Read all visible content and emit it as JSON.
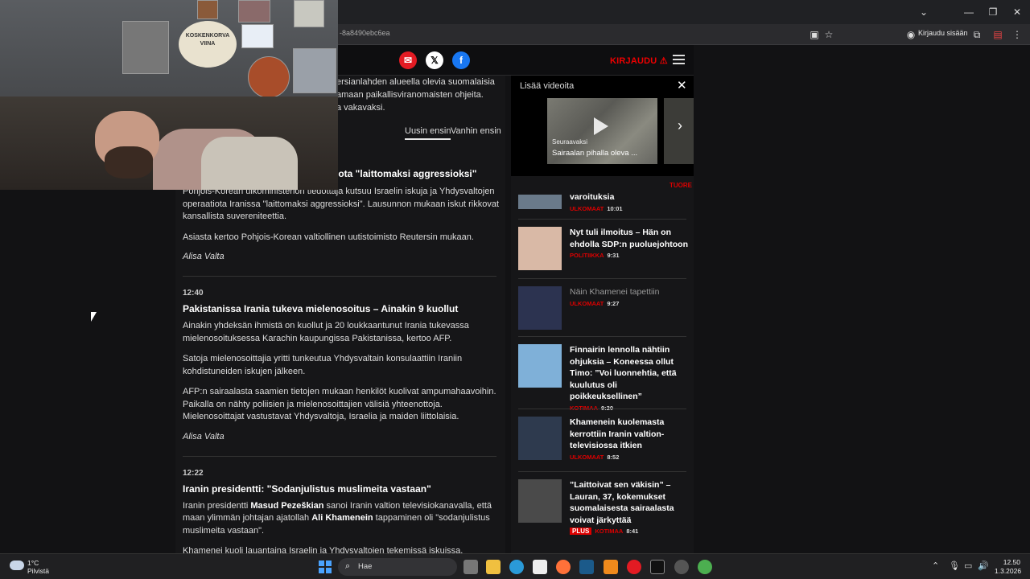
{
  "browser": {
    "url": "-8a8490ebc6ea",
    "signin_label": "Kirjaudu sisään",
    "minimize": "—",
    "restore": "❐",
    "close": "✕",
    "collapse": "⌄"
  },
  "site": {
    "login_label": "KIRJAUDU",
    "social": [
      "mail-icon",
      "x-icon",
      "facebook-icon"
    ]
  },
  "article": {
    "intro_lines": [
      "ersianlahden alueella olevia suomalaisia",
      "amaan paikallisviranomaisten ohjeita.",
      "a vakavaksi."
    ],
    "sort_newest": "Uusin ensin",
    "sort_oldest": "Vanhin ensin",
    "entries": [
      {
        "time": "",
        "title": "iota \"laittomaksi aggressioksi\"",
        "paragraphs": [
          "Pohjois-Korean ulkoministeriön tiedottaja kutsuu Israelin iskuja ja Yhdysvaltojen operaatiota Iranissa \"laittomaksi aggressioksi\". Lausunnon mukaan iskut rikkovat kansallista suvereniteettia.",
          "Asiasta kertoo Pohjois-Korean valtiollinen uutistoimisto Reutersin mukaan."
        ],
        "author": "Alisa Valta"
      },
      {
        "time": "12:40",
        "title": "Pakistanissa Irania tukeva mielenosoitus – Ainakin 9 kuollut",
        "paragraphs": [
          "Ainakin yhdeksän ihmistä on kuollut ja 20 loukkaantunut Irania tukevassa mielenosoituksessa Karachin kaupungissa Pakistanissa, kertoo AFP.",
          "Satoja mielenosoittajia yritti tunkeutua Yhdysvaltain konsulaattiin Iraniin kohdistuneiden iskujen jälkeen.",
          "AFP:n sairaalasta saamien tietojen mukaan henkilöt kuolivat ampumahaavoihin. Paikalla on nähty poliisien ja mielenosoittajien välisiä yhteenottoja. Mielenosoittajat vastustavat Yhdysvaltoja, Israelia ja maiden liittolaisia."
        ],
        "author": "Alisa Valta"
      },
      {
        "time": "12:22",
        "title": "Iranin presidentti: \"Sodanjulistus muslimeita vastaan\"",
        "p1_a": "Iranin presidentti ",
        "p1_b": "Masud Pezeškian",
        "p1_c": " sanoi Iranin valtion televisiokanavalla, että maan ylimmän johtajan ajatollah ",
        "p1_d": "Ali Khamenein",
        "p1_e": " tappaminen oli \"sodanjulistus muslimeita vastaan\".",
        "p2": "Khamenei kuoli lauantaina Israelin ja Yhdysvaltojen tekemissä iskuissa."
      }
    ]
  },
  "video": {
    "heading": "Lisää videoita",
    "next_label": "Seuraavaksi",
    "caption": "Sairaalan pihalla oleva ..."
  },
  "sidebar": {
    "latest_label": "TUORE",
    "items": [
      {
        "title": "varoituksia",
        "category": "ULKOMAAT",
        "time": "10:01",
        "grey": false,
        "plus": false,
        "img": "#6a7a8a"
      },
      {
        "title": "Nyt tuli ilmoitus – Hän on ehdolla SDP:n puoluejohtoon",
        "category": "POLITIIKKA",
        "time": "9:31",
        "grey": false,
        "plus": false,
        "img": "#d9b9a6"
      },
      {
        "title": "Näin Khamenei tapettiin",
        "category": "ULKOMAAT",
        "time": "9:27",
        "grey": true,
        "plus": false,
        "img": "#2c3350"
      },
      {
        "title": "Finnairin lennolla nähtiin ohjuksia – Koneessa ollut Timo: ”Voi luonnehtia, että kuulutus oli poikkeuksellinen”",
        "category": "KOTIMAA",
        "time": "9:20",
        "grey": false,
        "plus": false,
        "img": "#7fb0d8"
      },
      {
        "title": "Khamenein kuolemasta kerrottiin Iranin valtion­televisiossa itkien",
        "category": "ULKOMAAT",
        "time": "8:52",
        "grey": false,
        "plus": false,
        "img": "#2e3a4e"
      },
      {
        "title": "”Laittoivat sen väkisin” – Lauran, 37, kokemukset suomalaisesta sairaalasta voivat järkyttää",
        "category": "KOTIMAA",
        "time": "8:41",
        "grey": false,
        "plus": true,
        "plus_label": "PLUS",
        "img": "#4a4a4a"
      }
    ]
  },
  "webcam": {
    "sign_text": "KOSKENKORVA VIINA"
  },
  "taskbar": {
    "temp": "1°C",
    "condition": "Pilvistä",
    "search_placeholder": "Hae",
    "time": "12.50",
    "date": "1.3.2026"
  }
}
